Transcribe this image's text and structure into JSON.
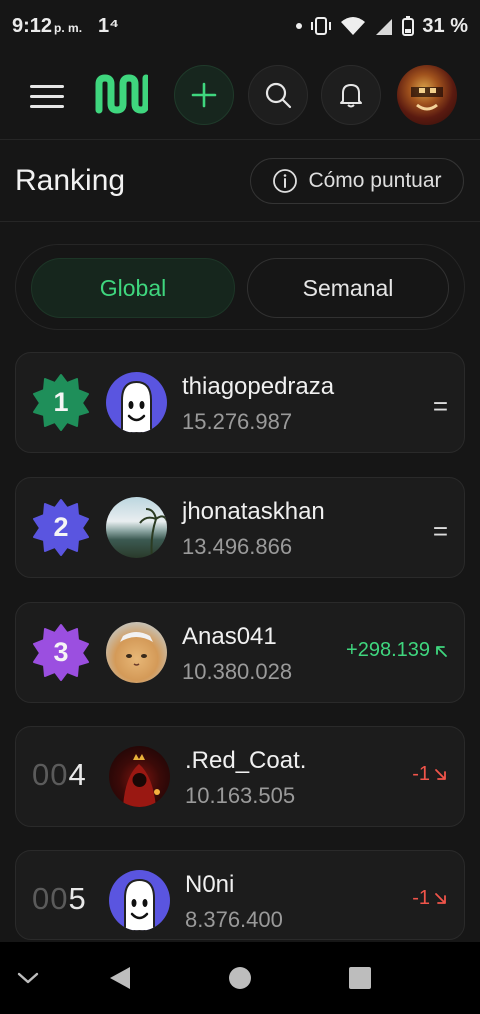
{
  "status_bar": {
    "time": "9:12",
    "ampm": "p. m.",
    "extra": "1⁴",
    "battery": "31 %"
  },
  "header": {
    "menu_icon": "hamburger-icon",
    "logo_icon": "app-logo-icon",
    "add_icon": "plus-icon",
    "search_icon": "search-icon",
    "bell_icon": "bell-icon",
    "accent": "#3fd67e"
  },
  "page": {
    "title": "Ranking",
    "how_to_score": "Cómo puntuar",
    "info_icon": "info-icon"
  },
  "tabs": {
    "global": "Global",
    "weekly": "Semanal",
    "active": "global"
  },
  "ranking": [
    {
      "position": "1",
      "badge_color": "#1f8f5a",
      "username": "thiagopedraza",
      "score": "15.276.987",
      "change": "=",
      "trend": "equal",
      "avatar": "ghost-avatar"
    },
    {
      "position": "2",
      "badge_color": "#5a55e0",
      "username": "jhonataskhan",
      "score": "13.496.866",
      "change": "=",
      "trend": "equal",
      "avatar": "beach-photo-avatar"
    },
    {
      "position": "3",
      "badge_color": "#9b4fe0",
      "username": "Anas041",
      "score": "10.380.028",
      "change": "+298.139",
      "trend": "up",
      "avatar": "cat-photo-avatar"
    },
    {
      "position_prefix": "00",
      "position": "4",
      "username": ".Red_Coat.",
      "score": "10.163.505",
      "change": "-1",
      "trend": "down",
      "avatar": "red-coat-avatar"
    },
    {
      "position_prefix": "00",
      "position": "5",
      "username": "N0ni",
      "score": "8.376.400",
      "change": "-1",
      "trend": "down",
      "avatar": "ghost-avatar"
    }
  ],
  "navbar": {
    "collapse_icon": "chevron-down-icon",
    "back_icon": "back-triangle-icon",
    "home_icon": "home-circle-icon",
    "recents_icon": "recents-square-icon"
  }
}
